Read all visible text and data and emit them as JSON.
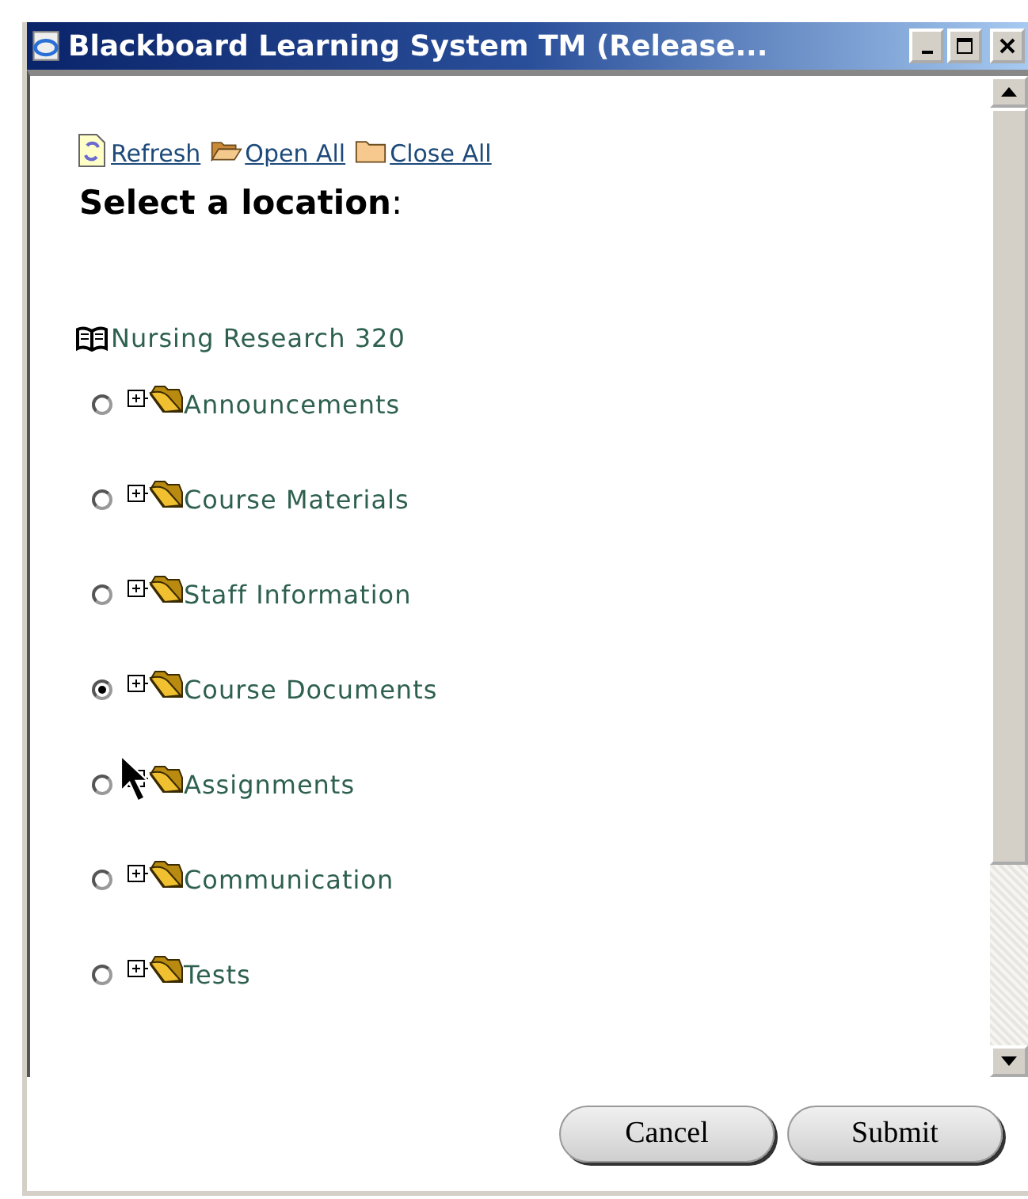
{
  "window": {
    "title": "Blackboard Learning System TM (Release..."
  },
  "toolbar": [
    {
      "label": "Refresh",
      "kind": "refresh"
    },
    {
      "label": "Open All",
      "kind": "open"
    },
    {
      "label": "Close All",
      "kind": "close"
    }
  ],
  "heading": "Select a location",
  "heading_suffix": ":",
  "course": "Nursing Research 320",
  "folders": [
    {
      "label": "Announcements",
      "selected": false
    },
    {
      "label": "Course Materials",
      "selected": false
    },
    {
      "label": "Staff Information",
      "selected": false
    },
    {
      "label": "Course Documents",
      "selected": true
    },
    {
      "label": "Assignments",
      "selected": false
    },
    {
      "label": "Communication",
      "selected": false
    },
    {
      "label": "Tests",
      "selected": false
    }
  ],
  "buttons": [
    "Cancel",
    "Submit"
  ]
}
